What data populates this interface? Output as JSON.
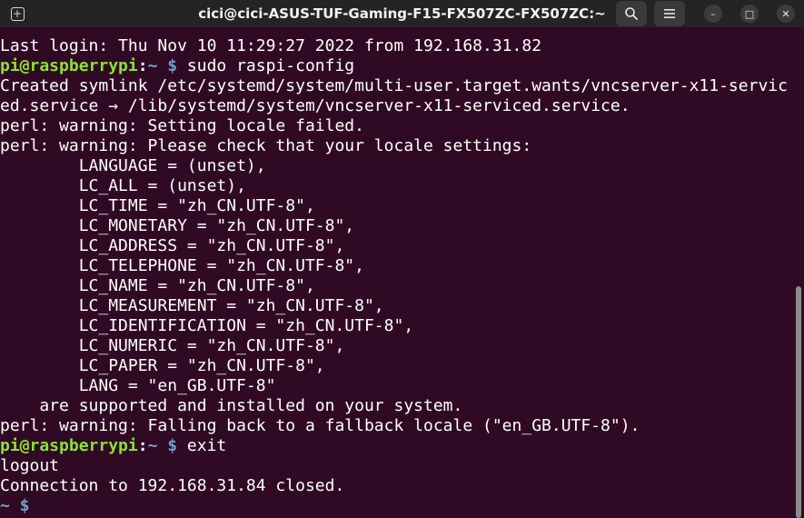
{
  "window": {
    "title": "cici@cici-ASUS-TUF-Gaming-F15-FX507ZC-FX507ZC:~",
    "new_tab_icon": "+",
    "search_icon": "search-icon",
    "menu_icon": "hamburger-menu-icon",
    "minimize_glyph": "–",
    "maximize_glyph": "□",
    "close_glyph": "✕"
  },
  "terminal": {
    "colors": {
      "background": "#300a24",
      "text": "#ffffff",
      "prompt_user": "#8ae234",
      "prompt_path": "#729fcf"
    },
    "lines": [
      {
        "text": "Last login: Thu Nov 10 11:29:27 2022 from 192.168.31.82"
      },
      {
        "user": "pi@raspberrypi",
        "colon": ":",
        "path": "~ $",
        "cmd": " sudo raspi-config"
      },
      {
        "text": "Created symlink /etc/systemd/system/multi-user.target.wants/vncserver-x11-servic"
      },
      {
        "text": "ed.service → /lib/systemd/system/vncserver-x11-serviced.service."
      },
      {
        "text": "perl: warning: Setting locale failed."
      },
      {
        "text": "perl: warning: Please check that your locale settings:"
      },
      {
        "text": "        LANGUAGE = (unset),"
      },
      {
        "text": "        LC_ALL = (unset),"
      },
      {
        "text": "        LC_TIME = \"zh_CN.UTF-8\","
      },
      {
        "text": "        LC_MONETARY = \"zh_CN.UTF-8\","
      },
      {
        "text": "        LC_ADDRESS = \"zh_CN.UTF-8\","
      },
      {
        "text": "        LC_TELEPHONE = \"zh_CN.UTF-8\","
      },
      {
        "text": "        LC_NAME = \"zh_CN.UTF-8\","
      },
      {
        "text": "        LC_MEASUREMENT = \"zh_CN.UTF-8\","
      },
      {
        "text": "        LC_IDENTIFICATION = \"zh_CN.UTF-8\","
      },
      {
        "text": "        LC_NUMERIC = \"zh_CN.UTF-8\","
      },
      {
        "text": "        LC_PAPER = \"zh_CN.UTF-8\","
      },
      {
        "text": "        LANG = \"en_GB.UTF-8\""
      },
      {
        "text": "    are supported and installed on your system."
      },
      {
        "text": "perl: warning: Falling back to a fallback locale (\"en_GB.UTF-8\")."
      },
      {
        "user": "pi@raspberrypi",
        "colon": ":",
        "path": "~ $",
        "cmd": " exit"
      },
      {
        "text": "logout"
      },
      {
        "text": "Connection to 192.168.31.84 closed."
      },
      {
        "path": "~ $",
        "cmd": ""
      }
    ]
  }
}
